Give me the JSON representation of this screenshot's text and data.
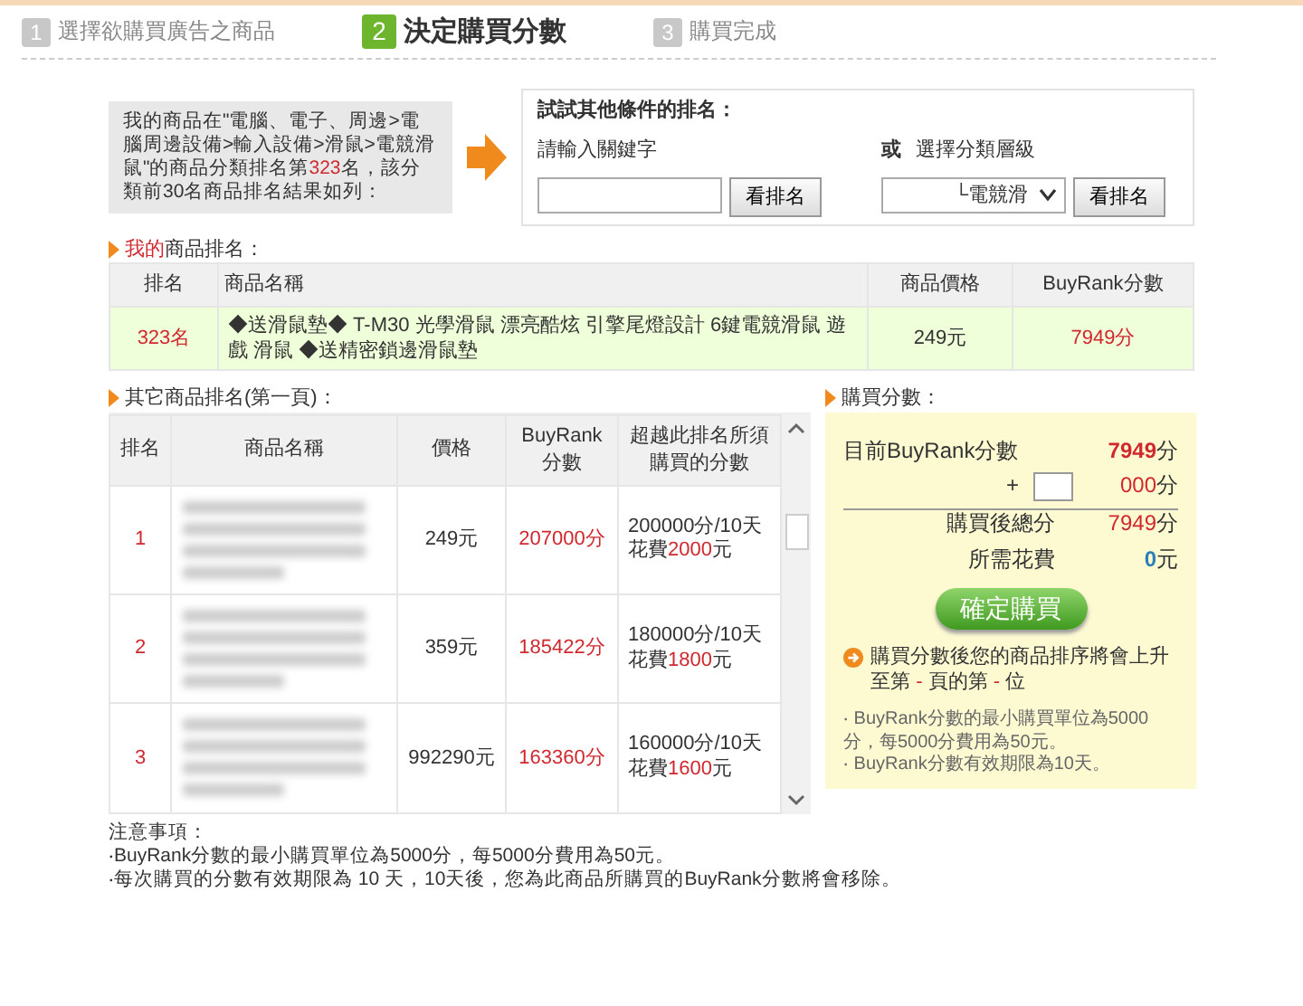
{
  "steps": [
    {
      "number": "1",
      "label": "選擇欲購買廣告之商品",
      "selected": false
    },
    {
      "number": "2",
      "label": "決定購買分數",
      "selected": true
    },
    {
      "number": "3",
      "label": "購買完成",
      "selected": false
    }
  ],
  "category_info": {
    "before": "我的商品在\"電腦、電子、周邊>電腦周邊設備>輸入設備>滑鼠>電競滑鼠\"的商品分類排名第",
    "rank": "323",
    "after": "名，該分類前30名商品排名結果如列："
  },
  "search": {
    "title": "試試其他條件的排名：",
    "keyword_label": "請輸入關鍵字",
    "keyword_button": "看排名",
    "or": "或",
    "category_label": "選擇分類層級",
    "category_value": "└電競滑",
    "category_button": "看排名"
  },
  "my_rank": {
    "title_highlight": "我的",
    "title": "商品排名：",
    "columns": [
      "排名",
      "商品名稱",
      "商品價格",
      "BuyRank分數"
    ],
    "row": {
      "rank": "323名",
      "name": "◆送滑鼠墊◆ T-M30 光學滑鼠 漂亮酷炫 引擎尾燈設計 6鍵電競滑鼠 遊戲 滑鼠 ◆送精密鎖邊滑鼠墊",
      "price": "249元",
      "score": "7949分"
    }
  },
  "others": {
    "title": "其它商品排名(第一頁)：",
    "columns": [
      "排名",
      "商品名稱",
      "價格",
      "BuyRank分數",
      "超越此排名所須購買的分數"
    ],
    "rows": [
      {
        "rank": "1",
        "price": "249元",
        "score": "207000分",
        "need": "200000分/10天",
        "cost_label": "花費",
        "cost": "2000",
        "cost_unit": "元"
      },
      {
        "rank": "2",
        "price": "359元",
        "score": "185422分",
        "need": "180000分/10天",
        "cost_label": "花費",
        "cost": "1800",
        "cost_unit": "元"
      },
      {
        "rank": "3",
        "price": "992290元",
        "score": "163360分",
        "need": "160000分/10天",
        "cost_label": "花費",
        "cost": "1600",
        "cost_unit": "元"
      }
    ]
  },
  "purchase": {
    "title": "購買分數：",
    "lines": [
      {
        "kind": "current",
        "label": "目前BuyRank分數",
        "value": "7949",
        "unit": "分"
      },
      {
        "kind": "input",
        "label": "+",
        "value": "000",
        "unit": "分"
      },
      {
        "kind": "total",
        "label": "購買後總分",
        "value": "7949",
        "unit": "分"
      },
      {
        "kind": "cost",
        "label": "所需花費",
        "value": "0",
        "unit": "元"
      }
    ],
    "button": "確定購買",
    "result_parts": [
      "購買分數後您的商品排序將會上升至第 ",
      "-",
      " 頁的第 ",
      "-",
      " 位"
    ],
    "hints": [
      "‧ BuyRank分數的最小購買單位為5000分，每5000分費用為50元。",
      "‧ BuyRank分數有效期限為10天。"
    ]
  },
  "notes": {
    "title": "注意事項：",
    "lines": [
      "‧BuyRank分數的最小購買單位為5000分，每5000分費用為50元。",
      "‧每次購買的分數有效期限為 10 天，10天後，您為此商品所購買的BuyRank分數將會移除。"
    ]
  }
}
